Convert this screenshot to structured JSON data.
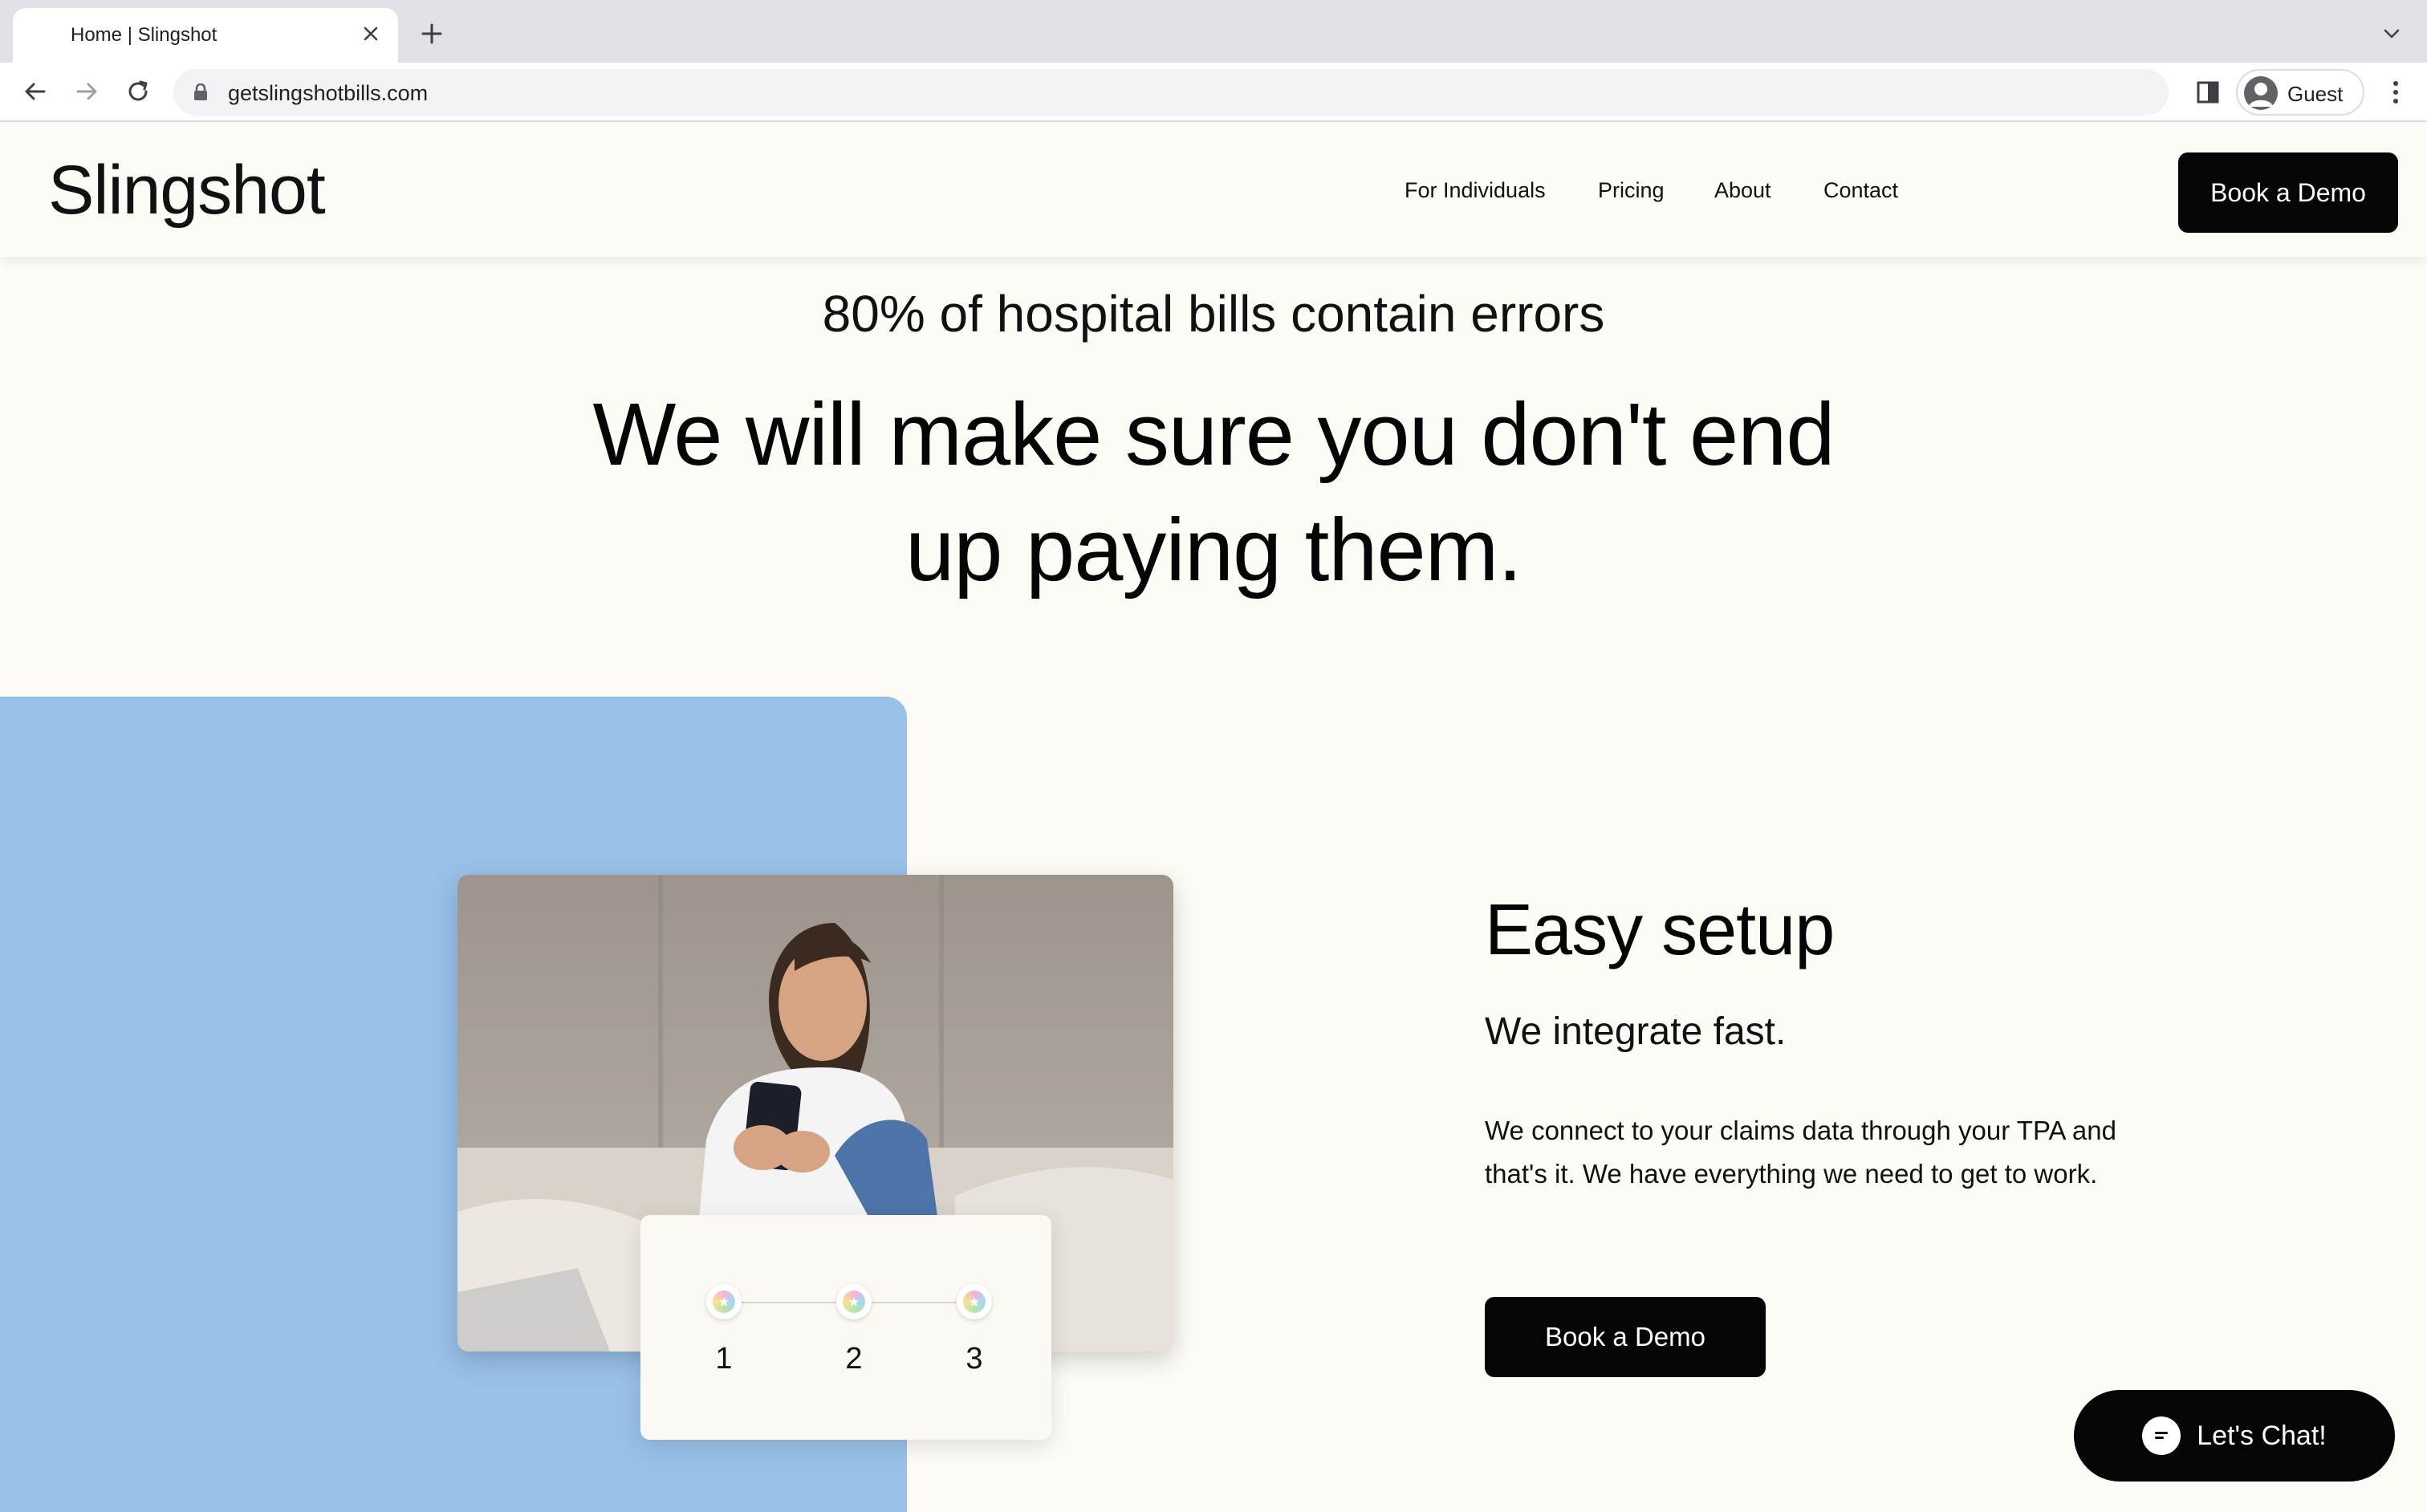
{
  "browser": {
    "tab_title": "Home | Slingshot",
    "url": "getslingshotbills.com",
    "profile_label": "Guest",
    "icons": {
      "close": "close-icon",
      "new_tab": "plus-icon",
      "tab_list": "chevron-down-icon",
      "back": "back-arrow-icon",
      "forward": "forward-arrow-icon",
      "reload": "reload-icon",
      "lock": "lock-icon",
      "side_panel": "side-panel-icon",
      "menu": "kebab-menu-icon"
    }
  },
  "site": {
    "logo": "Slingshot",
    "nav": [
      "For Individuals",
      "Pricing",
      "About",
      "Contact"
    ],
    "header_cta": "Book a Demo"
  },
  "hero": {
    "eyebrow": "80% of hospital bills contain errors",
    "title": "We will make sure you don't end up paying them."
  },
  "feature": {
    "title": "Easy setup",
    "subtitle": "We integrate fast.",
    "body": "We connect to your claims data through your TPA and that's it. We have everything we need to get to work.",
    "cta": "Book a Demo",
    "steps": [
      "1",
      "2",
      "3"
    ]
  },
  "chat": {
    "label": "Let's Chat!"
  },
  "colors": {
    "page_bg": "#fdfbf6",
    "accent_blue": "#98c1e8",
    "button_black": "#050505"
  }
}
